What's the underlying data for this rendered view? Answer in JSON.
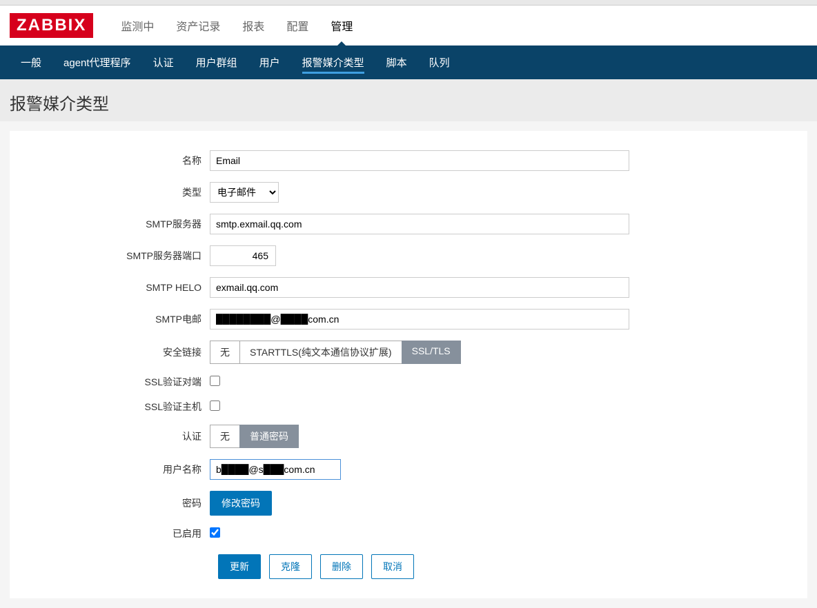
{
  "logo": "ZABBIX",
  "topnav": {
    "items": [
      {
        "label": "监测中"
      },
      {
        "label": "资产记录"
      },
      {
        "label": "报表"
      },
      {
        "label": "配置"
      },
      {
        "label": "管理"
      }
    ]
  },
  "subnav": {
    "items": [
      {
        "label": "一般"
      },
      {
        "label": "agent代理程序"
      },
      {
        "label": "认证"
      },
      {
        "label": "用户群组"
      },
      {
        "label": "用户"
      },
      {
        "label": "报警媒介类型"
      },
      {
        "label": "脚本"
      },
      {
        "label": "队列"
      }
    ]
  },
  "page_title": "报警媒介类型",
  "form": {
    "name_label": "名称",
    "name_value": "Email",
    "type_label": "类型",
    "type_value": "电子邮件",
    "smtp_server_label": "SMTP服务器",
    "smtp_server_value": "smtp.exmail.qq.com",
    "smtp_port_label": "SMTP服务器端口",
    "smtp_port_value": "465",
    "smtp_helo_label": "SMTP HELO",
    "smtp_helo_value": "exmail.qq.com",
    "smtp_email_label": "SMTP电邮",
    "smtp_email_value": "████████@████com.cn",
    "security_label": "安全链接",
    "security_options": [
      "无",
      "STARTTLS(纯文本通信协议扩展)",
      "SSL/TLS"
    ],
    "ssl_peer_label": "SSL验证对端",
    "ssl_host_label": "SSL验证主机",
    "auth_label": "认证",
    "auth_options": [
      "无",
      "普通密码"
    ],
    "username_label": "用户名称",
    "username_value": "b████@s███com.cn",
    "password_label": "密码",
    "password_button": "修改密码",
    "enabled_label": "已启用"
  },
  "buttons": {
    "update": "更新",
    "clone": "克隆",
    "delete": "删除",
    "cancel": "取消"
  }
}
